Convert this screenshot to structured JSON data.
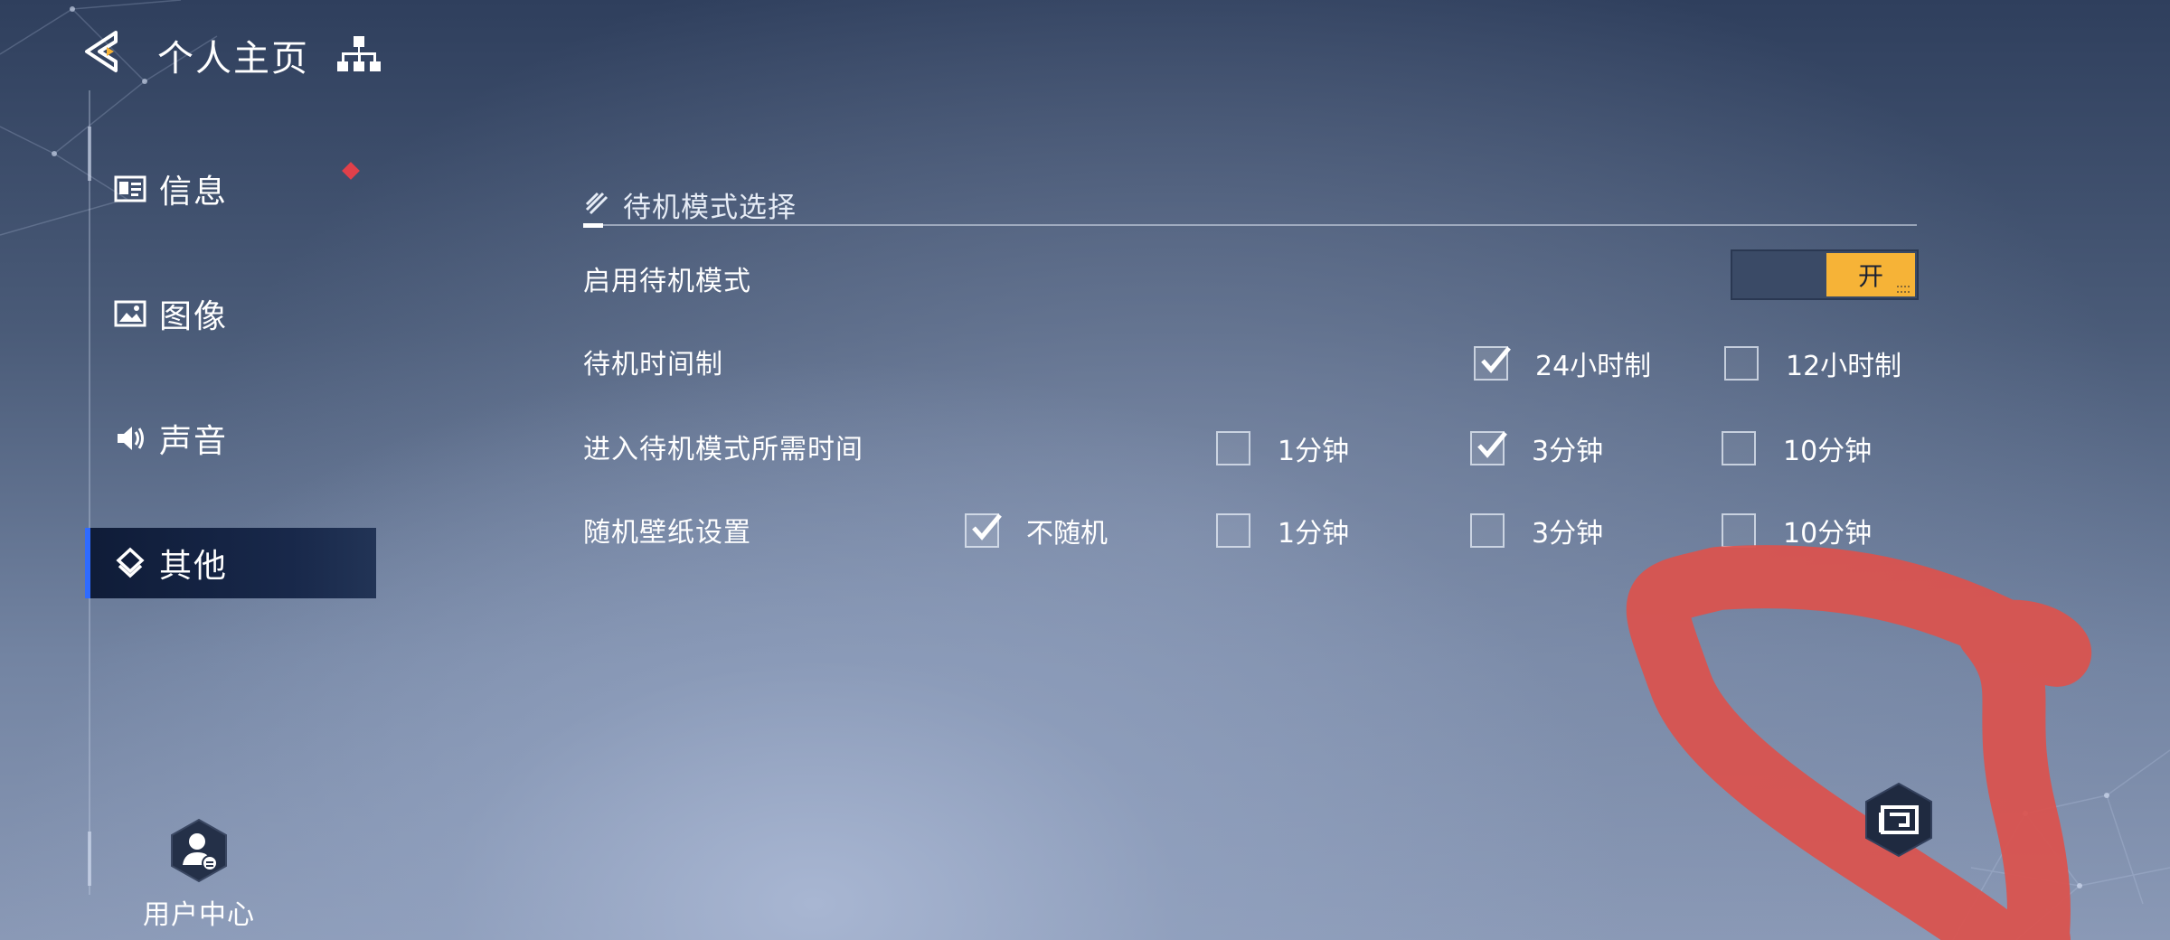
{
  "header": {
    "title": "个人主页",
    "back_icon": "back-arrow-icon",
    "tree_icon": "hierarchy-icon"
  },
  "sidebar": {
    "items": [
      {
        "label": "信息",
        "icon": "info-card-icon",
        "badge": true
      },
      {
        "label": "图像",
        "icon": "image-icon"
      },
      {
        "label": "声音",
        "icon": "speaker-icon"
      },
      {
        "label": "其他",
        "icon": "diamond-layers-icon",
        "active": true
      }
    ],
    "user_center": {
      "label": "用户中心",
      "icon": "user-hex-icon"
    }
  },
  "section": {
    "title": "待机模式选择"
  },
  "settings": {
    "enable_standby": {
      "label": "启用待机模式",
      "toggle_label": "开",
      "on": true
    },
    "time_format": {
      "label": "待机时间制",
      "options": [
        {
          "label": "24小时制",
          "checked": true
        },
        {
          "label": "12小时制",
          "checked": false
        }
      ]
    },
    "enter_time": {
      "label": "进入待机模式所需时间",
      "options": [
        {
          "label": "1分钟",
          "checked": false
        },
        {
          "label": "3分钟",
          "checked": true
        },
        {
          "label": "10分钟",
          "checked": false
        }
      ]
    },
    "random_wallpaper": {
      "label": "随机壁纸设置",
      "options": [
        {
          "label": "不随机",
          "checked": true
        },
        {
          "label": "1分钟",
          "checked": false
        },
        {
          "label": "3分钟",
          "checked": false
        },
        {
          "label": "10分钟",
          "checked": false
        }
      ]
    }
  },
  "fab": {
    "icon": "gallery-frame-icon"
  },
  "colors": {
    "accent": "#2f6bff",
    "toggle_on": "#f6b337",
    "badge": "#e0404a",
    "annotation": "#d9534f"
  }
}
